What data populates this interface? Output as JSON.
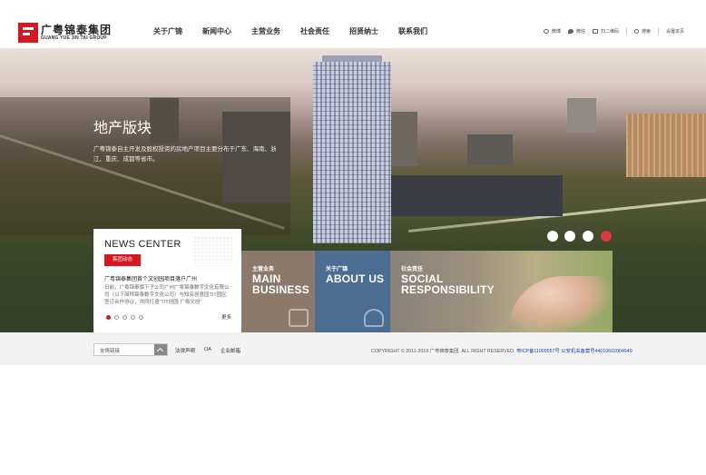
{
  "header": {
    "logo_cn": "广粤锦泰集团",
    "logo_en": "GUANG YUE JIN TAI GROUP",
    "nav": [
      "关于广锦",
      "新闻中心",
      "主营业务",
      "社会责任",
      "招贤纳士",
      "联系我们"
    ],
    "top_links": {
      "weibo": "微博",
      "wechat": "微信",
      "scan": "扫二维码",
      "search": "搜索",
      "set_home": "设置本页"
    }
  },
  "hero": {
    "title": "地产版块",
    "description": "广粤锦泰自主开发及股权投资的房地产项目主要分布于广东、海南、浙江、重庆、成都等省市。"
  },
  "news": {
    "title": "NEWS CENTER",
    "tag": "集团动态",
    "headline": "广粤锦泰集团首个文创园项目落户广州",
    "body": "日前，广粤锦泰旗下子公司广州广粤锦泰数字文化有限公司（以下简称锦泰数字文化公司）与知名创意园TIT园区签订合作协议，共同打造“TIT创园·广粤文创”",
    "more": "更多",
    "slides": 5,
    "active_slide": 1
  },
  "tiles": [
    {
      "sub": "主营业务",
      "en": "MAIN\nBUSINESS",
      "icon": "briefcase-icon"
    },
    {
      "sub": "关于广锦",
      "en": "ABOUT US",
      "icon": "people-icon"
    },
    {
      "sub": "社会责任",
      "en": "SOCIAL\nRESPONSIBILITY",
      "icon": "hands-icon"
    }
  ],
  "footer": {
    "select_value": "友情链接",
    "links": [
      "法律声明",
      "OA",
      "企业邮箱"
    ],
    "copyright": "COPYRIGHT © 2011-2019 广粤锦泰集团. ALL RIGHT RESERVED.",
    "icp": "粤ICP备11009557号",
    "police": "公安机关备案号44010602004949"
  },
  "colors": {
    "brand_red": "#d7161f",
    "tile_brown": "#8b796b",
    "tile_blue": "#4b6d92",
    "link_blue": "#1c3fb8"
  }
}
